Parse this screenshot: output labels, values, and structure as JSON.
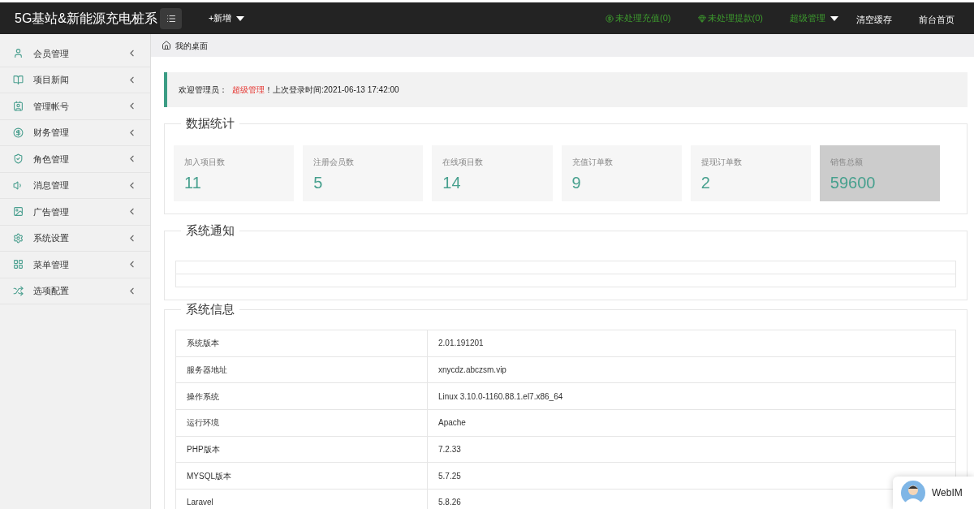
{
  "header": {
    "title": "5G基站&新能源充电桩系",
    "add_menu": "+新增",
    "links": [
      {
        "label": "未处理充值(0)",
        "kind": "yen"
      },
      {
        "label": "未处理提款(0)",
        "kind": "gem"
      },
      {
        "label": "超级管理",
        "kind": "dropdown"
      },
      {
        "label": "清空缓存",
        "kind": "plain"
      },
      {
        "label": "前台首页",
        "kind": "plain"
      }
    ]
  },
  "sidebar": {
    "items": [
      {
        "label": "会员管理"
      },
      {
        "label": "项目新闻"
      },
      {
        "label": "管理帐号"
      },
      {
        "label": "财务管理"
      },
      {
        "label": "角色管理"
      },
      {
        "label": "消息管理"
      },
      {
        "label": "广告管理"
      },
      {
        "label": "系统设置"
      },
      {
        "label": "菜单管理"
      },
      {
        "label": "选项配置"
      }
    ]
  },
  "breadcrumb": "我的桌面",
  "welcome": {
    "prefix": "欢迎管理员：",
    "role": "超级管理",
    "suffix": "！上次登录时间:2021-06-13 17:42:00"
  },
  "stats": {
    "title": "数据统计",
    "cards": [
      {
        "label": "加入项目数",
        "value": "11",
        "highlighted": false
      },
      {
        "label": "注册会员数",
        "value": "5",
        "highlighted": false
      },
      {
        "label": "在线项目数",
        "value": "14",
        "highlighted": false
      },
      {
        "label": "充值订单数",
        "value": "9",
        "highlighted": false
      },
      {
        "label": "提现订单数",
        "value": "2",
        "highlighted": false
      },
      {
        "label": "销售总额",
        "value": "59600",
        "highlighted": true
      }
    ]
  },
  "notice": {
    "title": "系统通知"
  },
  "sysinfo": {
    "title": "系统信息",
    "rows": [
      {
        "name": "系统版本",
        "value": "2.01.191201"
      },
      {
        "name": "服务器地址",
        "value": "xnycdz.abczsm.vip"
      },
      {
        "name": "操作系统",
        "value": "Linux 3.10.0-1160.88.1.el7.x86_64"
      },
      {
        "name": "运行环境",
        "value": "Apache"
      },
      {
        "name": "PHP版本",
        "value": "7.2.33"
      },
      {
        "name": "MYSQL版本",
        "value": "5.7.25"
      },
      {
        "name": "Laravel",
        "value": "5.8.26"
      }
    ]
  },
  "webim": {
    "label": "WebIM"
  }
}
